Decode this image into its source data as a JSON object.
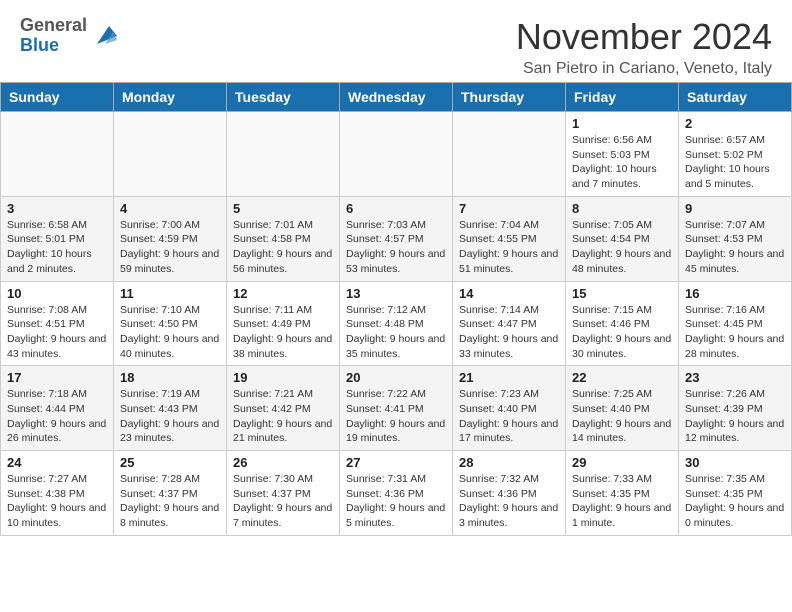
{
  "header": {
    "logo_general": "General",
    "logo_blue": "Blue",
    "month_title": "November 2024",
    "location": "San Pietro in Cariano, Veneto, Italy"
  },
  "days_of_week": [
    "Sunday",
    "Monday",
    "Tuesday",
    "Wednesday",
    "Thursday",
    "Friday",
    "Saturday"
  ],
  "weeks": [
    [
      {
        "day": "",
        "info": ""
      },
      {
        "day": "",
        "info": ""
      },
      {
        "day": "",
        "info": ""
      },
      {
        "day": "",
        "info": ""
      },
      {
        "day": "",
        "info": ""
      },
      {
        "day": "1",
        "info": "Sunrise: 6:56 AM\nSunset: 5:03 PM\nDaylight: 10 hours and 7 minutes."
      },
      {
        "day": "2",
        "info": "Sunrise: 6:57 AM\nSunset: 5:02 PM\nDaylight: 10 hours and 5 minutes."
      }
    ],
    [
      {
        "day": "3",
        "info": "Sunrise: 6:58 AM\nSunset: 5:01 PM\nDaylight: 10 hours and 2 minutes."
      },
      {
        "day": "4",
        "info": "Sunrise: 7:00 AM\nSunset: 4:59 PM\nDaylight: 9 hours and 59 minutes."
      },
      {
        "day": "5",
        "info": "Sunrise: 7:01 AM\nSunset: 4:58 PM\nDaylight: 9 hours and 56 minutes."
      },
      {
        "day": "6",
        "info": "Sunrise: 7:03 AM\nSunset: 4:57 PM\nDaylight: 9 hours and 53 minutes."
      },
      {
        "day": "7",
        "info": "Sunrise: 7:04 AM\nSunset: 4:55 PM\nDaylight: 9 hours and 51 minutes."
      },
      {
        "day": "8",
        "info": "Sunrise: 7:05 AM\nSunset: 4:54 PM\nDaylight: 9 hours and 48 minutes."
      },
      {
        "day": "9",
        "info": "Sunrise: 7:07 AM\nSunset: 4:53 PM\nDaylight: 9 hours and 45 minutes."
      }
    ],
    [
      {
        "day": "10",
        "info": "Sunrise: 7:08 AM\nSunset: 4:51 PM\nDaylight: 9 hours and 43 minutes."
      },
      {
        "day": "11",
        "info": "Sunrise: 7:10 AM\nSunset: 4:50 PM\nDaylight: 9 hours and 40 minutes."
      },
      {
        "day": "12",
        "info": "Sunrise: 7:11 AM\nSunset: 4:49 PM\nDaylight: 9 hours and 38 minutes."
      },
      {
        "day": "13",
        "info": "Sunrise: 7:12 AM\nSunset: 4:48 PM\nDaylight: 9 hours and 35 minutes."
      },
      {
        "day": "14",
        "info": "Sunrise: 7:14 AM\nSunset: 4:47 PM\nDaylight: 9 hours and 33 minutes."
      },
      {
        "day": "15",
        "info": "Sunrise: 7:15 AM\nSunset: 4:46 PM\nDaylight: 9 hours and 30 minutes."
      },
      {
        "day": "16",
        "info": "Sunrise: 7:16 AM\nSunset: 4:45 PM\nDaylight: 9 hours and 28 minutes."
      }
    ],
    [
      {
        "day": "17",
        "info": "Sunrise: 7:18 AM\nSunset: 4:44 PM\nDaylight: 9 hours and 26 minutes."
      },
      {
        "day": "18",
        "info": "Sunrise: 7:19 AM\nSunset: 4:43 PM\nDaylight: 9 hours and 23 minutes."
      },
      {
        "day": "19",
        "info": "Sunrise: 7:21 AM\nSunset: 4:42 PM\nDaylight: 9 hours and 21 minutes."
      },
      {
        "day": "20",
        "info": "Sunrise: 7:22 AM\nSunset: 4:41 PM\nDaylight: 9 hours and 19 minutes."
      },
      {
        "day": "21",
        "info": "Sunrise: 7:23 AM\nSunset: 4:40 PM\nDaylight: 9 hours and 17 minutes."
      },
      {
        "day": "22",
        "info": "Sunrise: 7:25 AM\nSunset: 4:40 PM\nDaylight: 9 hours and 14 minutes."
      },
      {
        "day": "23",
        "info": "Sunrise: 7:26 AM\nSunset: 4:39 PM\nDaylight: 9 hours and 12 minutes."
      }
    ],
    [
      {
        "day": "24",
        "info": "Sunrise: 7:27 AM\nSunset: 4:38 PM\nDaylight: 9 hours and 10 minutes."
      },
      {
        "day": "25",
        "info": "Sunrise: 7:28 AM\nSunset: 4:37 PM\nDaylight: 9 hours and 8 minutes."
      },
      {
        "day": "26",
        "info": "Sunrise: 7:30 AM\nSunset: 4:37 PM\nDaylight: 9 hours and 7 minutes."
      },
      {
        "day": "27",
        "info": "Sunrise: 7:31 AM\nSunset: 4:36 PM\nDaylight: 9 hours and 5 minutes."
      },
      {
        "day": "28",
        "info": "Sunrise: 7:32 AM\nSunset: 4:36 PM\nDaylight: 9 hours and 3 minutes."
      },
      {
        "day": "29",
        "info": "Sunrise: 7:33 AM\nSunset: 4:35 PM\nDaylight: 9 hours and 1 minute."
      },
      {
        "day": "30",
        "info": "Sunrise: 7:35 AM\nSunset: 4:35 PM\nDaylight: 9 hours and 0 minutes."
      }
    ]
  ]
}
